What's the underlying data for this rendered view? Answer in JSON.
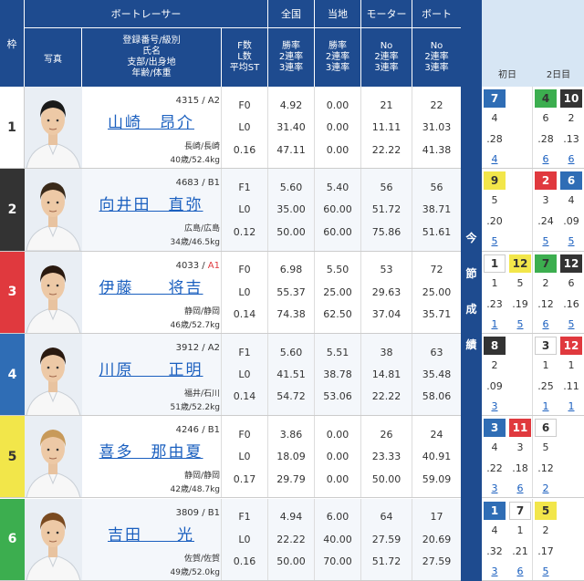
{
  "header": {
    "racer": "ボートレーサー",
    "national": "全国",
    "local": "当地",
    "motor": "モーター",
    "boat": "ボート",
    "waku": "枠",
    "photo": "写真",
    "profile": "登録番号/級別\n氏名\n支部/出身地\n年齢/体重",
    "fst": "F数\nL数\n平均ST",
    "nat_stats": "勝率\n2連率\n3連率",
    "loc_stats": "勝率\n2連率\n3連率",
    "motor_stats": "No\n2連率\n3連率",
    "boat_stats": "No\n2連率\n3連率",
    "konsetsu": [
      "今",
      "節",
      "成",
      "績"
    ],
    "day1": "初日",
    "day2": "2日目"
  },
  "racers": [
    {
      "waku": "1",
      "reg": "4315 / ",
      "cls": "A2",
      "cls_color": "#333",
      "name": "山崎　昂介",
      "home": "長崎/長崎",
      "agewt": "40歳/52.4kg",
      "f": "F0",
      "l": "L0",
      "st": "0.16",
      "nat": [
        "4.92",
        "31.40",
        "47.11"
      ],
      "loc": [
        "0.00",
        "0.00",
        "0.00"
      ],
      "motor": [
        "21",
        "11.11",
        "22.22"
      ],
      "boat": [
        "22",
        "31.03",
        "41.38"
      ],
      "bg": "#ffffff",
      "fg": "#333",
      "hair": "#1a1a1a"
    },
    {
      "waku": "2",
      "reg": "4683 / ",
      "cls": "B1",
      "cls_color": "#333",
      "name": "向井田　直弥",
      "home": "広島/広島",
      "agewt": "34歳/46.5kg",
      "f": "F1",
      "l": "L0",
      "st": "0.12",
      "nat": [
        "5.60",
        "35.00",
        "50.00"
      ],
      "loc": [
        "5.40",
        "60.00",
        "60.00"
      ],
      "motor": [
        "56",
        "51.72",
        "75.86"
      ],
      "boat": [
        "56",
        "38.71",
        "51.61"
      ],
      "bg": "#333333",
      "fg": "#fff",
      "hair": "#3a2a1a"
    },
    {
      "waku": "3",
      "reg": "4033 / ",
      "cls": "A1",
      "cls_color": "#e0393e",
      "name": "伊藤　　将吉",
      "home": "静岡/静岡",
      "agewt": "46歳/52.7kg",
      "f": "F0",
      "l": "L0",
      "st": "0.14",
      "nat": [
        "6.98",
        "55.37",
        "74.38"
      ],
      "loc": [
        "5.50",
        "25.00",
        "62.50"
      ],
      "motor": [
        "53",
        "29.63",
        "37.04"
      ],
      "boat": [
        "72",
        "25.00",
        "35.71"
      ],
      "bg": "#e0393e",
      "fg": "#fff",
      "hair": "#2a1a10"
    },
    {
      "waku": "4",
      "reg": "3912 / ",
      "cls": "A2",
      "cls_color": "#333",
      "name": "川原　　正明",
      "home": "福井/石川",
      "agewt": "51歳/52.2kg",
      "f": "F1",
      "l": "L0",
      "st": "0.14",
      "nat": [
        "5.60",
        "41.51",
        "54.72"
      ],
      "loc": [
        "5.51",
        "38.78",
        "53.06"
      ],
      "motor": [
        "38",
        "14.81",
        "22.22"
      ],
      "boat": [
        "63",
        "35.48",
        "58.06"
      ],
      "bg": "#2f6db5",
      "fg": "#fff",
      "hair": "#2a1a10"
    },
    {
      "waku": "5",
      "reg": "4246 / ",
      "cls": "B1",
      "cls_color": "#333",
      "name": "喜多　那由夏",
      "home": "静岡/静岡",
      "agewt": "42歳/48.7kg",
      "f": "F0",
      "l": "L0",
      "st": "0.17",
      "nat": [
        "3.86",
        "18.09",
        "29.79"
      ],
      "loc": [
        "0.00",
        "0.00",
        "0.00"
      ],
      "motor": [
        "26",
        "23.33",
        "50.00"
      ],
      "boat": [
        "24",
        "40.91",
        "59.09"
      ],
      "bg": "#f2e64a",
      "fg": "#333",
      "hair": "#c89a5a"
    },
    {
      "waku": "6",
      "reg": "3809 / ",
      "cls": "B1",
      "cls_color": "#333",
      "name": "吉田　　光",
      "home": "佐賀/佐賀",
      "agewt": "49歳/52.0kg",
      "f": "F1",
      "l": "L0",
      "st": "0.16",
      "nat": [
        "4.94",
        "22.22",
        "50.00"
      ],
      "loc": [
        "6.00",
        "40.00",
        "70.00"
      ],
      "motor": [
        "64",
        "27.59",
        "51.72"
      ],
      "boat": [
        "17",
        "20.69",
        "27.59"
      ],
      "bg": "#3cae4f",
      "fg": "#fff",
      "hair": "#7a4a20"
    }
  ],
  "results": [
    {
      "pills": [
        {
          "t": "7",
          "bg": "#2f6db5",
          "fg": "#fff"
        },
        {
          "t": "",
          "bg": "#fff",
          "fg": "#333"
        },
        {
          "t": "4",
          "bg": "#3cae4f",
          "fg": "#333"
        },
        {
          "t": "10",
          "bg": "#333",
          "fg": "#fff"
        }
      ],
      "r2": [
        "4",
        "",
        "6",
        "2"
      ],
      "r3": [
        ".28",
        "",
        ".28",
        ".13"
      ],
      "r4": [
        "4",
        "",
        "6",
        "6"
      ]
    },
    {
      "pills": [
        {
          "t": "9",
          "bg": "#f2e64a",
          "fg": "#333"
        },
        {
          "t": "",
          "bg": "#fff",
          "fg": "#333"
        },
        {
          "t": "2",
          "bg": "#e0393e",
          "fg": "#fff"
        },
        {
          "t": "6",
          "bg": "#2f6db5",
          "fg": "#fff"
        }
      ],
      "r2": [
        "5",
        "",
        "3",
        "4"
      ],
      "r3": [
        ".20",
        "",
        ".24",
        ".09"
      ],
      "r4": [
        "5",
        "",
        "5",
        "5"
      ]
    },
    {
      "pills": [
        {
          "t": "1",
          "bg": "#fff",
          "fg": "#333"
        },
        {
          "t": "12",
          "bg": "#f2e64a",
          "fg": "#333"
        },
        {
          "t": "7",
          "bg": "#3cae4f",
          "fg": "#333"
        },
        {
          "t": "12",
          "bg": "#333",
          "fg": "#fff"
        }
      ],
      "r2": [
        "1",
        "5",
        "2",
        "6"
      ],
      "r3": [
        ".23",
        ".19",
        ".12",
        ".16"
      ],
      "r4": [
        "1",
        "5",
        "6",
        "5"
      ]
    },
    {
      "pills": [
        {
          "t": "8",
          "bg": "#333",
          "fg": "#fff"
        },
        {
          "t": "",
          "bg": "#fff",
          "fg": "#333"
        },
        {
          "t": "3",
          "bg": "#fff",
          "fg": "#333"
        },
        {
          "t": "12",
          "bg": "#e0393e",
          "fg": "#fff"
        }
      ],
      "r2": [
        "2",
        "",
        "1",
        "1"
      ],
      "r3": [
        ".09",
        "",
        ".25",
        ".11"
      ],
      "r4": [
        "3",
        "",
        "1",
        "1"
      ]
    },
    {
      "pills": [
        {
          "t": "3",
          "bg": "#2f6db5",
          "fg": "#fff"
        },
        {
          "t": "11",
          "bg": "#e0393e",
          "fg": "#fff"
        },
        {
          "t": "6",
          "bg": "#fff",
          "fg": "#333"
        },
        {
          "t": "",
          "bg": "#fff",
          "fg": "#333"
        }
      ],
      "r2": [
        "4",
        "3",
        "5",
        ""
      ],
      "r3": [
        ".22",
        ".18",
        ".12",
        ""
      ],
      "r4": [
        "3",
        "6",
        "2",
        ""
      ]
    },
    {
      "pills": [
        {
          "t": "1",
          "bg": "#2f6db5",
          "fg": "#fff"
        },
        {
          "t": "7",
          "bg": "#fff",
          "fg": "#333"
        },
        {
          "t": "5",
          "bg": "#f2e64a",
          "fg": "#333"
        },
        {
          "t": "",
          "bg": "#fff",
          "fg": "#333"
        }
      ],
      "r2": [
        "4",
        "1",
        "2",
        ""
      ],
      "r3": [
        ".32",
        ".21",
        ".17",
        ""
      ],
      "r4": [
        "3",
        "6",
        "5",
        ""
      ]
    }
  ]
}
